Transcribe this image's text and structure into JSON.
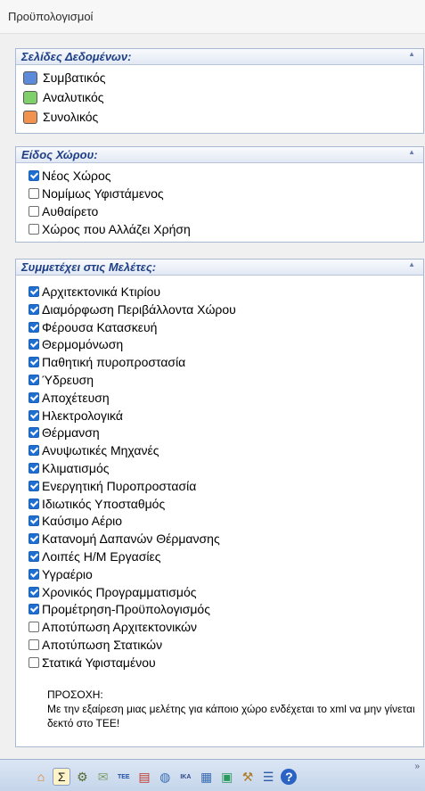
{
  "window": {
    "title": "Προϋπολογισμοί"
  },
  "panels": {
    "data_pages": {
      "title": "Σελίδες Δεδομένων:",
      "items": [
        {
          "label": "Συμβατικός",
          "color": "#5b8bd9"
        },
        {
          "label": "Αναλυτικός",
          "color": "#7fcf6a"
        },
        {
          "label": "Συνολικός",
          "color": "#f2924f"
        }
      ]
    },
    "space_type": {
      "title": "Είδος Χώρου:",
      "items": [
        {
          "label": "Νέος Χώρος",
          "checked": true
        },
        {
          "label": "Νομίμως Υφιστάμενος",
          "checked": false
        },
        {
          "label": "Αυθαίρετο",
          "checked": false
        },
        {
          "label": "Χώρος που Αλλάζει Χρήση",
          "checked": false
        }
      ]
    },
    "studies": {
      "title": "Συμμετέχει στις Μελέτες:",
      "items": [
        {
          "label": "Αρχιτεκτονικά Κτιρίου",
          "checked": true
        },
        {
          "label": "Διαμόρφωση Περιβάλλοντα Χώρου",
          "checked": true
        },
        {
          "label": "Φέρουσα Κατασκευή",
          "checked": true
        },
        {
          "label": "Θερμομόνωση",
          "checked": true
        },
        {
          "label": "Παθητική πυροπροστασία",
          "checked": true
        },
        {
          "label": "Ύδρευση",
          "checked": true
        },
        {
          "label": "Αποχέτευση",
          "checked": true
        },
        {
          "label": "Ηλεκτρολογικά",
          "checked": true
        },
        {
          "label": "Θέρμανση",
          "checked": true
        },
        {
          "label": "Ανυψωτικές Μηχανές",
          "checked": true
        },
        {
          "label": "Κλιματισμός",
          "checked": true
        },
        {
          "label": "Ενεργητική Πυροπροστασία",
          "checked": true
        },
        {
          "label": "Ιδιωτικός Υποσταθμός",
          "checked": true
        },
        {
          "label": "Καύσιμο Αέριο",
          "checked": true
        },
        {
          "label": "Κατανομή Δαπανών Θέρμανσης",
          "checked": true
        },
        {
          "label": "Λοιπές Η/Μ Εργασίες",
          "checked": true
        },
        {
          "label": "Υγραέριο",
          "checked": true
        },
        {
          "label": "Χρονικός Προγραμματισμός",
          "checked": true
        },
        {
          "label": "Προμέτρηση-Προϋπολογισμός",
          "checked": true
        },
        {
          "label": "Αποτύπωση Αρχιτεκτονικών",
          "checked": false
        },
        {
          "label": "Αποτύπωση Στατικών",
          "checked": false
        },
        {
          "label": "Στατικά Υφισταμένου",
          "checked": false
        }
      ],
      "note_heading": "ΠΡΟΣΟΧΗ:",
      "note_text": "Με την εξαίρεση μιας μελέτης για κάποιο χώρο ενδέχεται το xml να μην γίνεται δεκτό στο ΤΕΕ!"
    }
  },
  "toolbar": {
    "buttons": [
      {
        "icon": "home-icon",
        "glyph": "⌂",
        "color": "#e07a1a"
      },
      {
        "icon": "sigma-icon",
        "glyph": "Σ",
        "color": "#222222",
        "active": true
      },
      {
        "icon": "gear-sheet-icon",
        "glyph": "⚙",
        "color": "#556b2f"
      },
      {
        "icon": "envelope-icon",
        "glyph": "✉",
        "color": "#7fa06a"
      },
      {
        "icon": "tee-logo-icon",
        "glyph": "ΤΕΕ",
        "color": "#1f4fa8"
      },
      {
        "icon": "document-icon",
        "glyph": "▤",
        "color": "#c0392b"
      },
      {
        "icon": "globe-icon",
        "glyph": "◍",
        "color": "#3a6fb3"
      },
      {
        "icon": "ika-logo-icon",
        "glyph": "ΙΚΑ",
        "color": "#2c4a8a"
      },
      {
        "icon": "table-icon",
        "glyph": "▦",
        "color": "#3b6db3"
      },
      {
        "icon": "calendar-icon",
        "glyph": "▣",
        "color": "#2a9a5a"
      },
      {
        "icon": "tools-icon",
        "glyph": "⚒",
        "color": "#b07a22"
      },
      {
        "icon": "list-icon",
        "glyph": "☰",
        "color": "#2b5aa8"
      },
      {
        "icon": "help-icon",
        "glyph": "?",
        "color": "#ffffff"
      }
    ],
    "overflow": "»"
  }
}
